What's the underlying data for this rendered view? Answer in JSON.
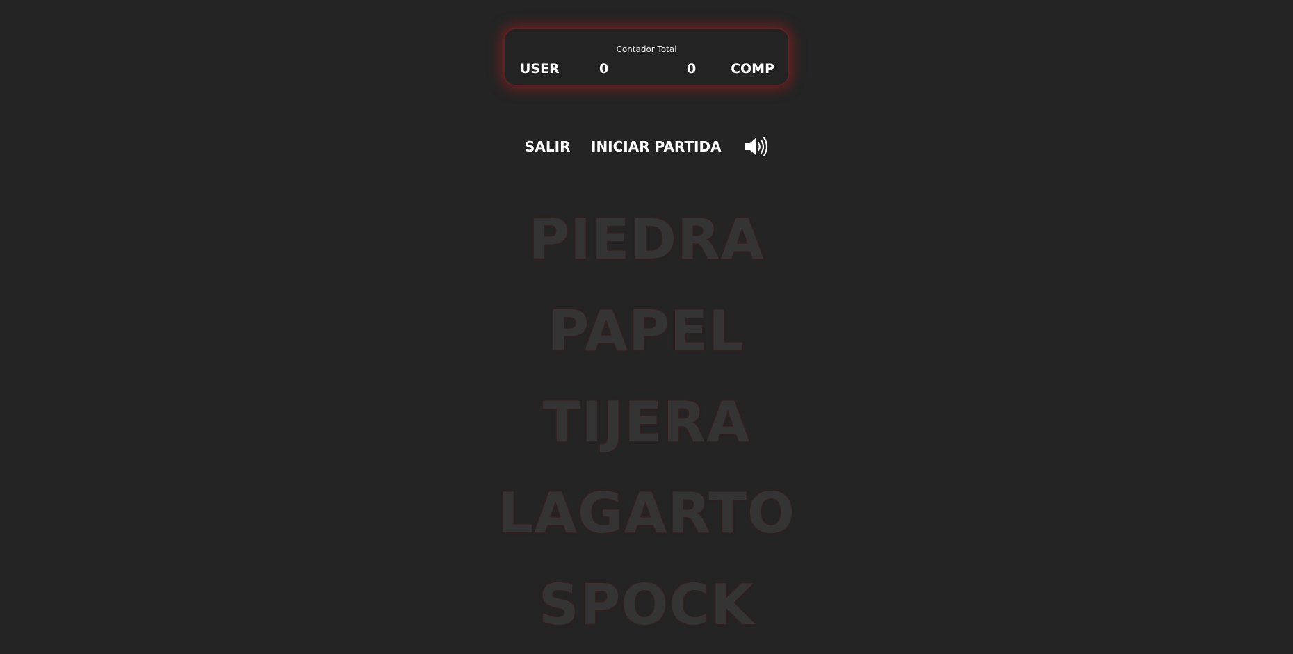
{
  "scoreboard": {
    "title": "Contador Total",
    "user_label": "USER",
    "user_score": "0",
    "comp_score": "0",
    "comp_label": "COMP"
  },
  "menu": {
    "exit_label": "SALIR",
    "start_label": "INICIAR PARTIDA",
    "sound_icon": "speaker-volume-icon"
  },
  "choices": [
    {
      "label": "PIEDRA"
    },
    {
      "label": "PAPEL"
    },
    {
      "label": "TIJERA"
    },
    {
      "label": "LAGARTO"
    },
    {
      "label": "SPOCK"
    }
  ],
  "colors": {
    "background": "#242424",
    "scoreboard_glow": "#aa1e1e",
    "choice_text": "#343434",
    "text": "#ffffff"
  }
}
